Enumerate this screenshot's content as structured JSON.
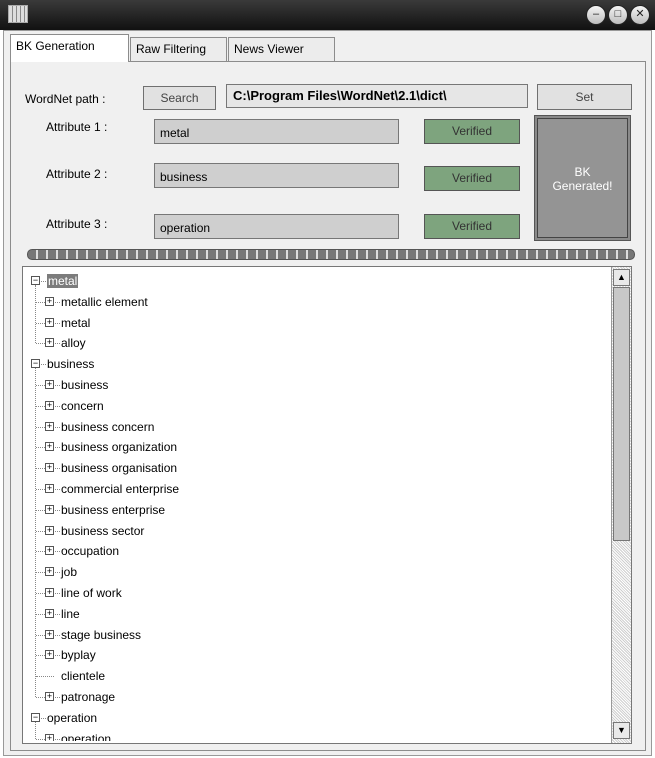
{
  "titlebar": {
    "minimize_glyph": "–",
    "maximize_glyph": "□",
    "close_glyph": "✕"
  },
  "tabs": [
    {
      "label": "BK Generation"
    },
    {
      "label": "Raw Filtering"
    },
    {
      "label": "News Viewer"
    }
  ],
  "wordnet": {
    "label": "WordNet path :",
    "search_label": "Search",
    "path_value": "C:\\Program Files\\WordNet\\2.1\\dict\\",
    "set_label": "Set"
  },
  "attributes": [
    {
      "label": "Attribute 1 :",
      "value": "metal",
      "status": "Verified"
    },
    {
      "label": "Attribute 2 :",
      "value": "business",
      "status": "Verified"
    },
    {
      "label": "Attribute 3 :",
      "value": "operation",
      "status": "Verified"
    }
  ],
  "bk_status": {
    "line1": "BK",
    "line2": "Generated!"
  },
  "colors": {
    "verified": "#7ea47e",
    "selected": "#7c7c7c",
    "titlebar": "#1e1e1e"
  },
  "tree": {
    "nodes": [
      {
        "label": "metal",
        "children": [
          "metallic element",
          "metal",
          "alloy"
        ]
      },
      {
        "label": "business",
        "children": [
          "business",
          "concern",
          "business concern",
          "business organization",
          "business organisation",
          "commercial enterprise",
          "business enterprise",
          "business sector",
          "occupation",
          "job",
          "line of work",
          "line",
          "stage business",
          "byplay",
          "clientele",
          "patronage"
        ]
      },
      {
        "label": "operation",
        "children": [
          "operation"
        ]
      }
    ],
    "leaf_items": [
      "clientele"
    ],
    "selected": "metal"
  },
  "scrollbar": {
    "up_glyph": "▲",
    "down_glyph": "▼"
  }
}
